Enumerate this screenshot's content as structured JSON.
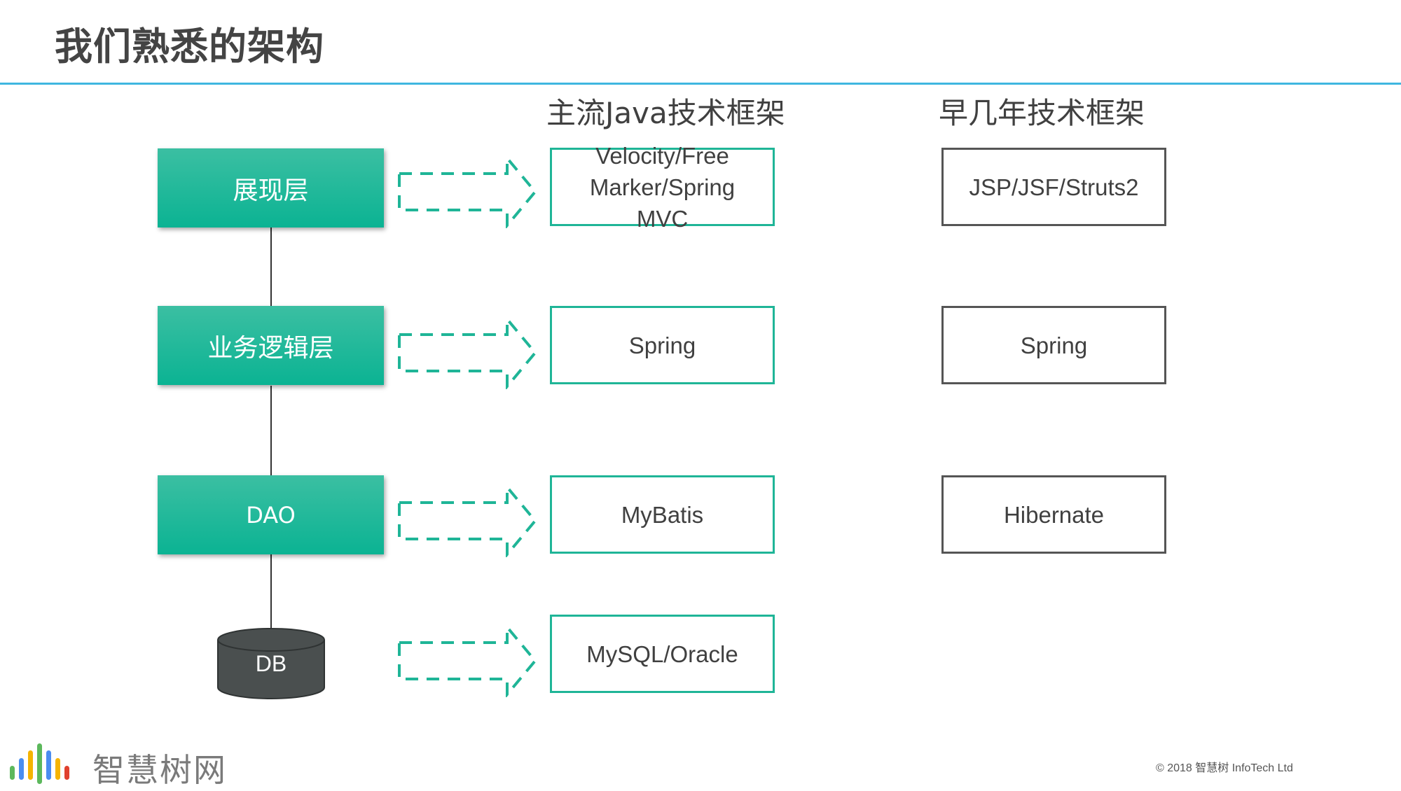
{
  "title": "我们熟悉的架构",
  "columns": {
    "mainstream": "主流Java技术框架",
    "earlier": "早几年技术框架"
  },
  "layers": [
    {
      "label": "展现层"
    },
    {
      "label": "业务逻辑层"
    },
    {
      "label": "DAO"
    },
    {
      "label": "DB"
    }
  ],
  "mainstream_frameworks": [
    {
      "line1": "Velocity/Free",
      "line2": "Marker/Spring",
      "line3": "MVC"
    },
    {
      "label": "Spring"
    },
    {
      "label": "MyBatis"
    },
    {
      "label": "MySQL/Oracle"
    }
  ],
  "earlier_frameworks": [
    {
      "label": "JSP/JSF/Struts2"
    },
    {
      "label": "Spring"
    },
    {
      "label": "Hibernate"
    }
  ],
  "colors": {
    "accent_teal": "#0bb393",
    "rule_blue": "#3fb6e0",
    "db_dark": "#4a4f4f"
  },
  "footer": {
    "logo_text": "智慧树网",
    "copyright": "© 2018 智慧树 InfoTech Ltd"
  }
}
